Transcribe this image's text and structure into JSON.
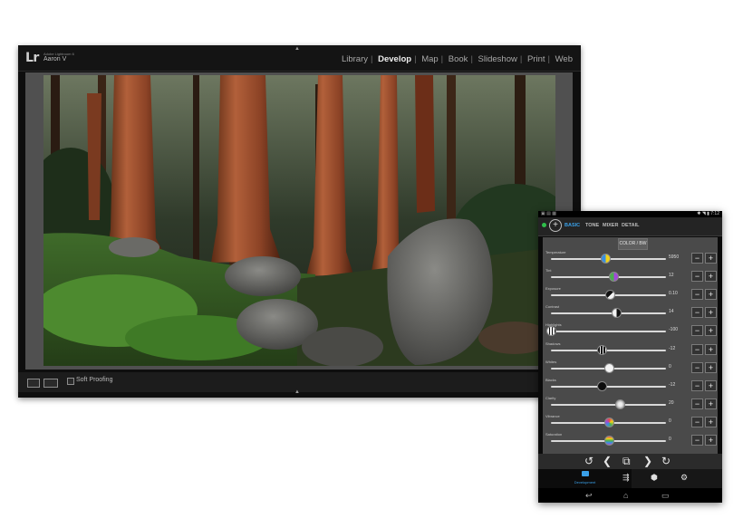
{
  "lightroom": {
    "logo": "Lr",
    "ident_small": "Adobe Lightroom 6",
    "ident_user": "Aaron V",
    "modules": [
      "Library",
      "Develop",
      "Map",
      "Book",
      "Slideshow",
      "Print",
      "Web"
    ],
    "active_module": "Develop",
    "soft_proofing_label": "Soft Proofing"
  },
  "tablet": {
    "status_time": "7:12",
    "tabs": [
      "BASIC",
      "TONE",
      "MIXER",
      "DETAIL"
    ],
    "active_tab": "BASIC",
    "color_bw_button": "COLOR / BW",
    "sliders": [
      {
        "label": "Temperature",
        "value": "5950",
        "level": 0.47
      },
      {
        "label": "Tint",
        "value": "12",
        "level": 0.54
      },
      {
        "label": "Exposure",
        "value": "0.10",
        "level": 0.51
      },
      {
        "label": "Contrast",
        "value": "14",
        "level": 0.57
      },
      {
        "label": "Highlights",
        "value": "-100",
        "level": 0.0
      },
      {
        "label": "Shadows",
        "value": "-12",
        "level": 0.44
      },
      {
        "label": "Whites",
        "value": "0",
        "level": 0.5
      },
      {
        "label": "Blacks",
        "value": "-12",
        "level": 0.44
      },
      {
        "label": "Clarity",
        "value": "20",
        "level": 0.6
      },
      {
        "label": "Vibrance",
        "value": "0",
        "level": 0.5
      },
      {
        "label": "Saturation",
        "value": "0",
        "level": 0.5
      }
    ],
    "minus_symbol": "−",
    "plus_symbol": "+",
    "bottom_mode_label": "Development",
    "colors": {
      "accent": "#3aa0e8",
      "connection": "#2fbf4a"
    }
  }
}
